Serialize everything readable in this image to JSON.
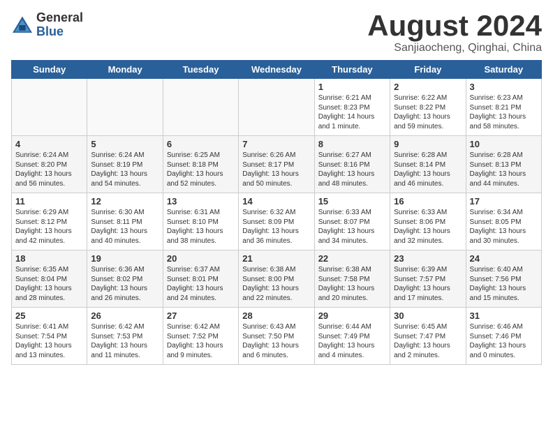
{
  "logo": {
    "general": "General",
    "blue": "Blue"
  },
  "header": {
    "month": "August 2024",
    "location": "Sanjiaocheng, Qinghai, China"
  },
  "days_of_week": [
    "Sunday",
    "Monday",
    "Tuesday",
    "Wednesday",
    "Thursday",
    "Friday",
    "Saturday"
  ],
  "weeks": [
    [
      {
        "num": "",
        "info": ""
      },
      {
        "num": "",
        "info": ""
      },
      {
        "num": "",
        "info": ""
      },
      {
        "num": "",
        "info": ""
      },
      {
        "num": "1",
        "info": "Sunrise: 6:21 AM\nSunset: 8:23 PM\nDaylight: 14 hours\nand 1 minute."
      },
      {
        "num": "2",
        "info": "Sunrise: 6:22 AM\nSunset: 8:22 PM\nDaylight: 13 hours\nand 59 minutes."
      },
      {
        "num": "3",
        "info": "Sunrise: 6:23 AM\nSunset: 8:21 PM\nDaylight: 13 hours\nand 58 minutes."
      }
    ],
    [
      {
        "num": "4",
        "info": "Sunrise: 6:24 AM\nSunset: 8:20 PM\nDaylight: 13 hours\nand 56 minutes."
      },
      {
        "num": "5",
        "info": "Sunrise: 6:24 AM\nSunset: 8:19 PM\nDaylight: 13 hours\nand 54 minutes."
      },
      {
        "num": "6",
        "info": "Sunrise: 6:25 AM\nSunset: 8:18 PM\nDaylight: 13 hours\nand 52 minutes."
      },
      {
        "num": "7",
        "info": "Sunrise: 6:26 AM\nSunset: 8:17 PM\nDaylight: 13 hours\nand 50 minutes."
      },
      {
        "num": "8",
        "info": "Sunrise: 6:27 AM\nSunset: 8:16 PM\nDaylight: 13 hours\nand 48 minutes."
      },
      {
        "num": "9",
        "info": "Sunrise: 6:28 AM\nSunset: 8:14 PM\nDaylight: 13 hours\nand 46 minutes."
      },
      {
        "num": "10",
        "info": "Sunrise: 6:28 AM\nSunset: 8:13 PM\nDaylight: 13 hours\nand 44 minutes."
      }
    ],
    [
      {
        "num": "11",
        "info": "Sunrise: 6:29 AM\nSunset: 8:12 PM\nDaylight: 13 hours\nand 42 minutes."
      },
      {
        "num": "12",
        "info": "Sunrise: 6:30 AM\nSunset: 8:11 PM\nDaylight: 13 hours\nand 40 minutes."
      },
      {
        "num": "13",
        "info": "Sunrise: 6:31 AM\nSunset: 8:10 PM\nDaylight: 13 hours\nand 38 minutes."
      },
      {
        "num": "14",
        "info": "Sunrise: 6:32 AM\nSunset: 8:09 PM\nDaylight: 13 hours\nand 36 minutes."
      },
      {
        "num": "15",
        "info": "Sunrise: 6:33 AM\nSunset: 8:07 PM\nDaylight: 13 hours\nand 34 minutes."
      },
      {
        "num": "16",
        "info": "Sunrise: 6:33 AM\nSunset: 8:06 PM\nDaylight: 13 hours\nand 32 minutes."
      },
      {
        "num": "17",
        "info": "Sunrise: 6:34 AM\nSunset: 8:05 PM\nDaylight: 13 hours\nand 30 minutes."
      }
    ],
    [
      {
        "num": "18",
        "info": "Sunrise: 6:35 AM\nSunset: 8:04 PM\nDaylight: 13 hours\nand 28 minutes."
      },
      {
        "num": "19",
        "info": "Sunrise: 6:36 AM\nSunset: 8:02 PM\nDaylight: 13 hours\nand 26 minutes."
      },
      {
        "num": "20",
        "info": "Sunrise: 6:37 AM\nSunset: 8:01 PM\nDaylight: 13 hours\nand 24 minutes."
      },
      {
        "num": "21",
        "info": "Sunrise: 6:38 AM\nSunset: 8:00 PM\nDaylight: 13 hours\nand 22 minutes."
      },
      {
        "num": "22",
        "info": "Sunrise: 6:38 AM\nSunset: 7:58 PM\nDaylight: 13 hours\nand 20 minutes."
      },
      {
        "num": "23",
        "info": "Sunrise: 6:39 AM\nSunset: 7:57 PM\nDaylight: 13 hours\nand 17 minutes."
      },
      {
        "num": "24",
        "info": "Sunrise: 6:40 AM\nSunset: 7:56 PM\nDaylight: 13 hours\nand 15 minutes."
      }
    ],
    [
      {
        "num": "25",
        "info": "Sunrise: 6:41 AM\nSunset: 7:54 PM\nDaylight: 13 hours\nand 13 minutes."
      },
      {
        "num": "26",
        "info": "Sunrise: 6:42 AM\nSunset: 7:53 PM\nDaylight: 13 hours\nand 11 minutes."
      },
      {
        "num": "27",
        "info": "Sunrise: 6:42 AM\nSunset: 7:52 PM\nDaylight: 13 hours\nand 9 minutes."
      },
      {
        "num": "28",
        "info": "Sunrise: 6:43 AM\nSunset: 7:50 PM\nDaylight: 13 hours\nand 6 minutes."
      },
      {
        "num": "29",
        "info": "Sunrise: 6:44 AM\nSunset: 7:49 PM\nDaylight: 13 hours\nand 4 minutes."
      },
      {
        "num": "30",
        "info": "Sunrise: 6:45 AM\nSunset: 7:47 PM\nDaylight: 13 hours\nand 2 minutes."
      },
      {
        "num": "31",
        "info": "Sunrise: 6:46 AM\nSunset: 7:46 PM\nDaylight: 13 hours\nand 0 minutes."
      }
    ]
  ]
}
